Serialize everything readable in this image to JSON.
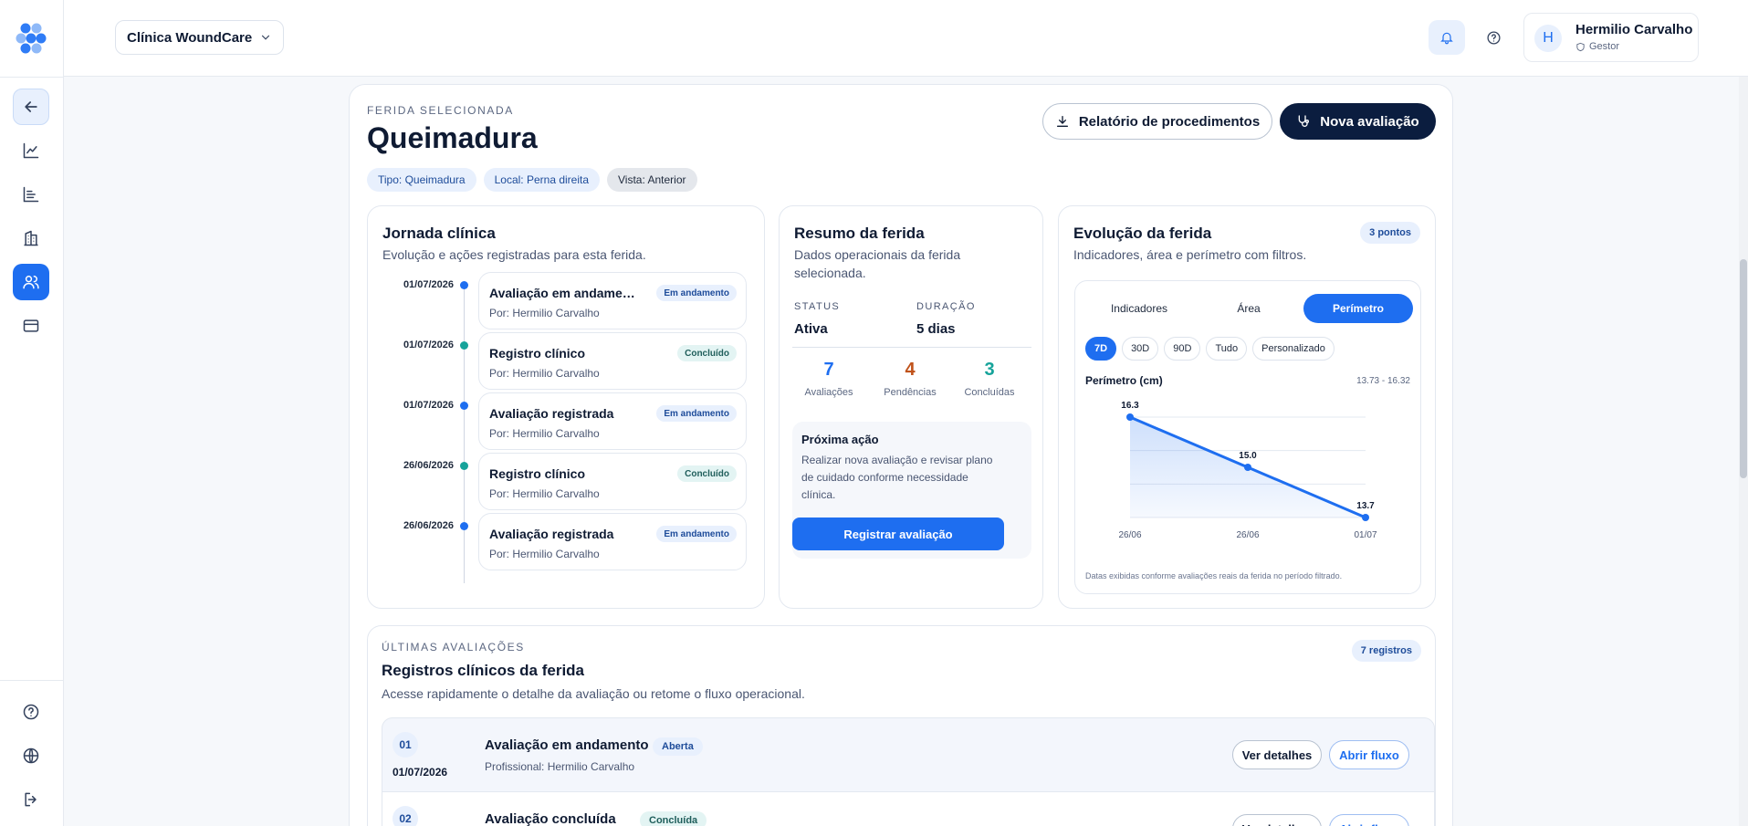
{
  "header": {
    "clinic": "Clínica WoundCare",
    "user_name": "Hermilio Carvalho",
    "user_initial": "H",
    "user_role": "Gestor"
  },
  "wound": {
    "eyebrow": "FERIDA SELECIONADA",
    "title": "Queimadura",
    "chips": [
      "Tipo: Queimadura",
      "Local: Perna direita",
      "Vista: Anterior"
    ],
    "report_button": "Relatório de procedimentos",
    "new_eval_button": "Nova avaliação"
  },
  "journey": {
    "title": "Jornada clínica",
    "subtitle": "Evolução e ações registradas para esta ferida.",
    "items": [
      {
        "date": "01/07/2026",
        "title": "Avaliação em andamento",
        "by": "Por: Hermilio Carvalho",
        "badge": "Em andamento",
        "dot_color": "#1e6ef0"
      },
      {
        "date": "01/07/2026",
        "title": "Registro clínico",
        "by": "Por: Hermilio Carvalho",
        "badge": "Concluído",
        "dot_color": "#16a39a"
      },
      {
        "date": "01/07/2026",
        "title": "Avaliação registrada",
        "by": "Por: Hermilio Carvalho",
        "badge": "Em andamento",
        "dot_color": "#1e6ef0"
      },
      {
        "date": "26/06/2026",
        "title": "Registro clínico",
        "by": "Por: Hermilio Carvalho",
        "badge": "Concluído",
        "dot_color": "#16a39a"
      },
      {
        "date": "26/06/2026",
        "title": "Avaliação registrada",
        "by": "Por: Hermilio Carvalho",
        "badge": "Em andamento",
        "dot_color": "#1e6ef0"
      }
    ]
  },
  "summary": {
    "title": "Resumo da ferida",
    "subtitle_line1": "Dados operacionais da ferida",
    "subtitle_line2": "selecionada.",
    "status_label": "STATUS",
    "status_value": "Ativa",
    "duration_label": "DURAÇÃO",
    "duration_value": "5 dias",
    "stats": [
      {
        "value": "7",
        "label": "Avaliações",
        "color": "#1e6ef0"
      },
      {
        "value": "4",
        "label": "Pendências",
        "color": "#c0531b"
      },
      {
        "value": "3",
        "label": "Concluídas",
        "color": "#16a39a"
      }
    ],
    "next_title": "Próxima ação",
    "next_lines": [
      "Realizar nova avaliação e revisar plano",
      "de cuidado conforme necessidade",
      "clínica."
    ],
    "register_button": "Registrar avaliação"
  },
  "evolution": {
    "title": "Evolução da ferida",
    "subtitle": "Indicadores, área e perímetro com filtros.",
    "points_badge": "3 pontos",
    "tabs": [
      "Indicadores",
      "Área",
      "Perímetro"
    ],
    "active_tab": "Perímetro",
    "ranges": [
      "7D",
      "30D",
      "90D",
      "Tudo",
      "Personalizado"
    ],
    "active_range": "7D",
    "footnote": "Datas exibidas conforme avaliações reais da ferida no período filtrado."
  },
  "chart_data": {
    "type": "area",
    "title": "Perímetro (cm)",
    "range_label": "13.73 - 16.32",
    "categories": [
      "26/06",
      "26/06",
      "01/07"
    ],
    "values": [
      16.3,
      15.0,
      13.7
    ],
    "data_labels": [
      "16.3",
      "15.0",
      "13.7"
    ],
    "ylim": [
      13.7,
      16.3
    ],
    "grid": true,
    "color": "#1e6ef0"
  },
  "evaluations": {
    "eyebrow": "ÚLTIMAS AVALIAÇÕES",
    "title": "Registros clínicos da ferida",
    "subtitle": "Acesse rapidamente o detalhe da avaliação ou retome o fluxo operacional.",
    "count_badge": "7 registros",
    "rows": [
      {
        "num": "01",
        "date": "01/07/2026",
        "title": "Avaliação em andamento",
        "status": "Aberta",
        "professional": "Profissional: Hermilio Carvalho",
        "details": "Ver detalhes",
        "flow": "Abrir fluxo"
      },
      {
        "num": "02",
        "date": "",
        "title": "Avaliação concluída",
        "status": "Concluída",
        "professional": "",
        "details": "Ver detalhes",
        "flow": "Abrir fluxo"
      }
    ]
  }
}
